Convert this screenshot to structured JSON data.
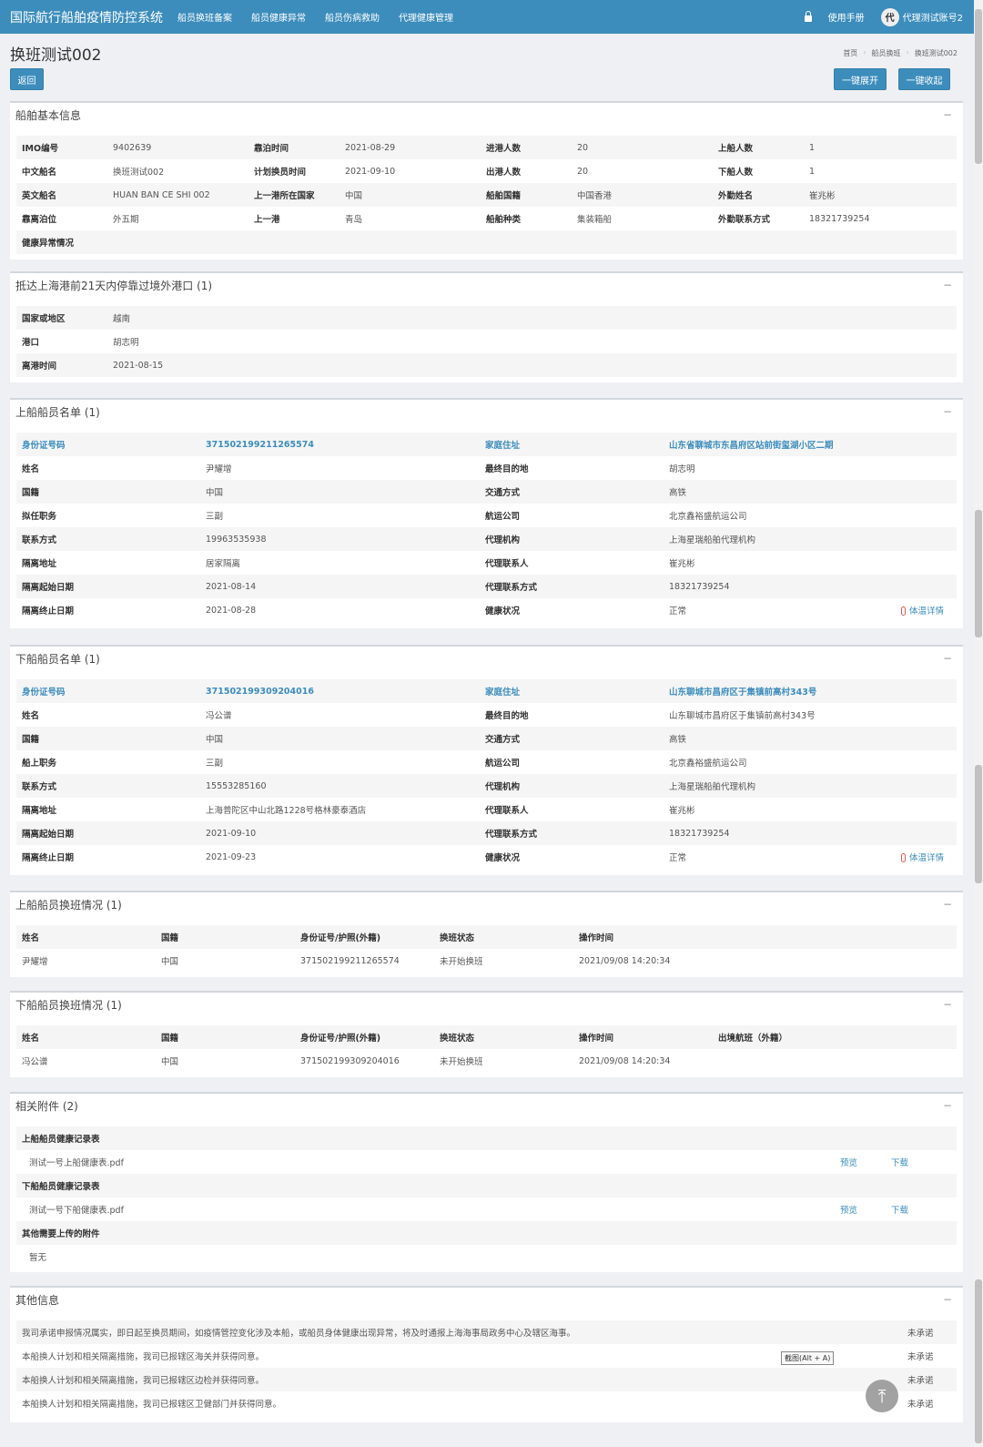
{
  "header": {
    "brand": "国际航行船舶疫情防控系统",
    "nav": [
      "船员换班备案",
      "船员健康异常",
      "船员伤病救助",
      "代理健康管理"
    ],
    "manual": "使用手册",
    "avatar": "代",
    "username": "代理测试账号2"
  },
  "page": {
    "title": "换班测试002",
    "back": "返回",
    "expand_all": "一键展开",
    "collapse_all": "一键收起",
    "breadcrumb": [
      "首页",
      "船员换班",
      "换班测试002"
    ]
  },
  "ship_info": {
    "title": "船舶基本信息",
    "rows": [
      [
        [
          "IMO编号",
          "9402639"
        ],
        [
          "靠泊时间",
          "2021-08-29"
        ],
        [
          "进港人数",
          "20"
        ],
        [
          "上船人数",
          "1"
        ]
      ],
      [
        [
          "中文船名",
          "换班测试002"
        ],
        [
          "计划换员时间",
          "2021-09-10"
        ],
        [
          "出港人数",
          "20"
        ],
        [
          "下船人数",
          "1"
        ]
      ],
      [
        [
          "英文船名",
          "HUAN BAN CE SHI 002"
        ],
        [
          "上一港所在国家",
          "中国"
        ],
        [
          "船舶国籍",
          "中国香港"
        ],
        [
          "外勤姓名",
          "崔兆彬"
        ]
      ],
      [
        [
          "靠离泊位",
          "外五期"
        ],
        [
          "上一港",
          "青岛"
        ],
        [
          "船舶种类",
          "集装箱船"
        ],
        [
          "外勤联系方式",
          "18321739254"
        ]
      ],
      [
        [
          "健康异常情况",
          ""
        ],
        [
          "",
          ""
        ],
        [
          "",
          ""
        ],
        [
          "",
          ""
        ]
      ]
    ]
  },
  "ports": {
    "title": "抵达上海港前21天内停靠过境外港口 (1)",
    "rows": [
      [
        "国家或地区",
        "越南"
      ],
      [
        "港口",
        "胡志明"
      ],
      [
        "离港时间",
        "2021-08-15"
      ]
    ]
  },
  "board_crew": {
    "title": "上船船员名单 (1)",
    "id_label": "身份证号码",
    "id_value": "371502199211265574",
    "addr_label": "家庭住址",
    "addr_value": "山东省聊城市东昌府区站前街玺湖小区二期",
    "rows": [
      [
        "姓名",
        "尹耀增",
        "最终目的地",
        "胡志明"
      ],
      [
        "国籍",
        "中国",
        "交通方式",
        "高铁"
      ],
      [
        "拟任职务",
        "三副",
        "航运公司",
        "北京鑫裕盛航运公司"
      ],
      [
        "联系方式",
        "19963535938",
        "代理机构",
        "上海星瑞船舶代理机构"
      ],
      [
        "隔离地址",
        "居家隔离",
        "代理联系人",
        "崔兆彬"
      ],
      [
        "隔离起始日期",
        "2021-08-14",
        "代理联系方式",
        "18321739254"
      ],
      [
        "隔离终止日期",
        "2021-08-28",
        "健康状况",
        "正常"
      ]
    ],
    "temp": "体温详情"
  },
  "leave_crew": {
    "title": "下船船员名单 (1)",
    "id_label": "身份证号码",
    "id_value": "371502199309204016",
    "addr_label": "家庭住址",
    "addr_value": "山东聊城市昌府区于集镇前高村343号",
    "rows": [
      [
        "姓名",
        "冯公谱",
        "最终目的地",
        "山东聊城市昌府区于集镇前高村343号"
      ],
      [
        "国籍",
        "中国",
        "交通方式",
        "高铁"
      ],
      [
        "船上职务",
        "三副",
        "航运公司",
        "北京鑫裕盛航运公司"
      ],
      [
        "联系方式",
        "15553285160",
        "代理机构",
        "上海星瑞船舶代理机构"
      ],
      [
        "隔离地址",
        "上海普陀区中山北路1228号格林豪泰酒店",
        "代理联系人",
        "崔兆彬"
      ],
      [
        "隔离起始日期",
        "2021-09-10",
        "代理联系方式",
        "18321739254"
      ],
      [
        "隔离终止日期",
        "2021-09-23",
        "健康状况",
        "正常"
      ]
    ],
    "temp": "体温详情"
  },
  "board_change": {
    "title": "上船船员换班情况 (1)",
    "headers": [
      "姓名",
      "国籍",
      "身份证号/护照(外籍)",
      "换班状态",
      "操作时间"
    ],
    "rows": [
      [
        "尹耀增",
        "中国",
        "371502199211265574",
        "未开始换班",
        "2021/09/08 14:20:34"
      ]
    ]
  },
  "leave_change": {
    "title": "下船船员换班情况 (1)",
    "headers": [
      "姓名",
      "国籍",
      "身份证号/护照(外籍)",
      "换班状态",
      "操作时间",
      "出境航班（外籍）"
    ],
    "rows": [
      [
        "冯公谱",
        "中国",
        "371502199309204016",
        "未开始换班",
        "2021/09/08 14:20:34",
        ""
      ]
    ]
  },
  "attachments": {
    "title": "相关附件 (2)",
    "preview": "预览",
    "download": "下载",
    "groups": [
      {
        "label": "上船船员健康记录表",
        "file": "测试一号上船健康表.pdf"
      },
      {
        "label": "下船船员健康记录表",
        "file": "测试一号下船健康表.pdf"
      },
      {
        "label": "其他需要上传的附件",
        "file": "暂无"
      }
    ]
  },
  "other": {
    "title": "其他信息",
    "rows": [
      [
        "我司承诺申报情况属实，即日起至换员期间，如疫情管控变化涉及本船，或船员身体健康出现异常，将及时通报上海海事局政务中心及辖区海事。",
        "未承诺"
      ],
      [
        "本船换人计划和相关隔离措施，我司已报辖区海关并获得同意。",
        "未承诺"
      ],
      [
        "本船换人计划和相关隔离措施，我司已报辖区边检并获得同意。",
        "未承诺"
      ],
      [
        "本船换人计划和相关隔离措施，我司已报辖区卫健部门并获得同意。",
        "未承诺"
      ]
    ],
    "tooltip": "截图(Alt + A)"
  },
  "collapse_glyph": "−",
  "top_glyph": "⤒"
}
